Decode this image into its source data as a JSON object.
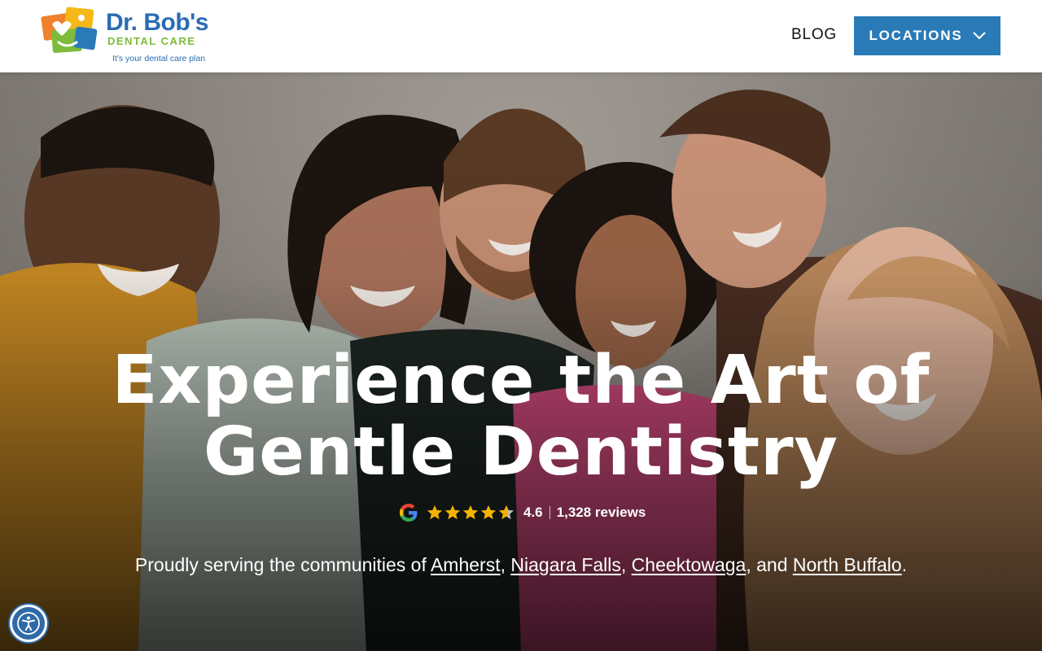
{
  "header": {
    "logo": {
      "name": "Dr. Bob's",
      "sub": "DENTAL CARE",
      "tagline": "It's your dental care plan"
    },
    "nav": {
      "blog": "BLOG",
      "locations": "LOCATIONS"
    }
  },
  "hero": {
    "headline_line1": "Experience the Art of",
    "headline_line2": "Gentle Dentistry",
    "rating": {
      "value": "4.6",
      "reviews": "1,328 reviews",
      "stars": 4.6
    },
    "serving": {
      "prefix": "Proudly serving the communities of ",
      "locations": [
        "Amherst",
        "Niagara Falls",
        "Cheektowaga",
        "North Buffalo"
      ],
      "sep1": ", ",
      "sep2": ", ",
      "sep3": ", and ",
      "suffix": "."
    }
  },
  "colors": {
    "brand_blue": "#2a7ab8",
    "logo_green": "#7dbb3a",
    "star_gold": "#f5b301"
  },
  "icons": {
    "accessibility": "accessibility-icon",
    "google": "google-icon",
    "dropdown": "chevron-down-icon"
  }
}
